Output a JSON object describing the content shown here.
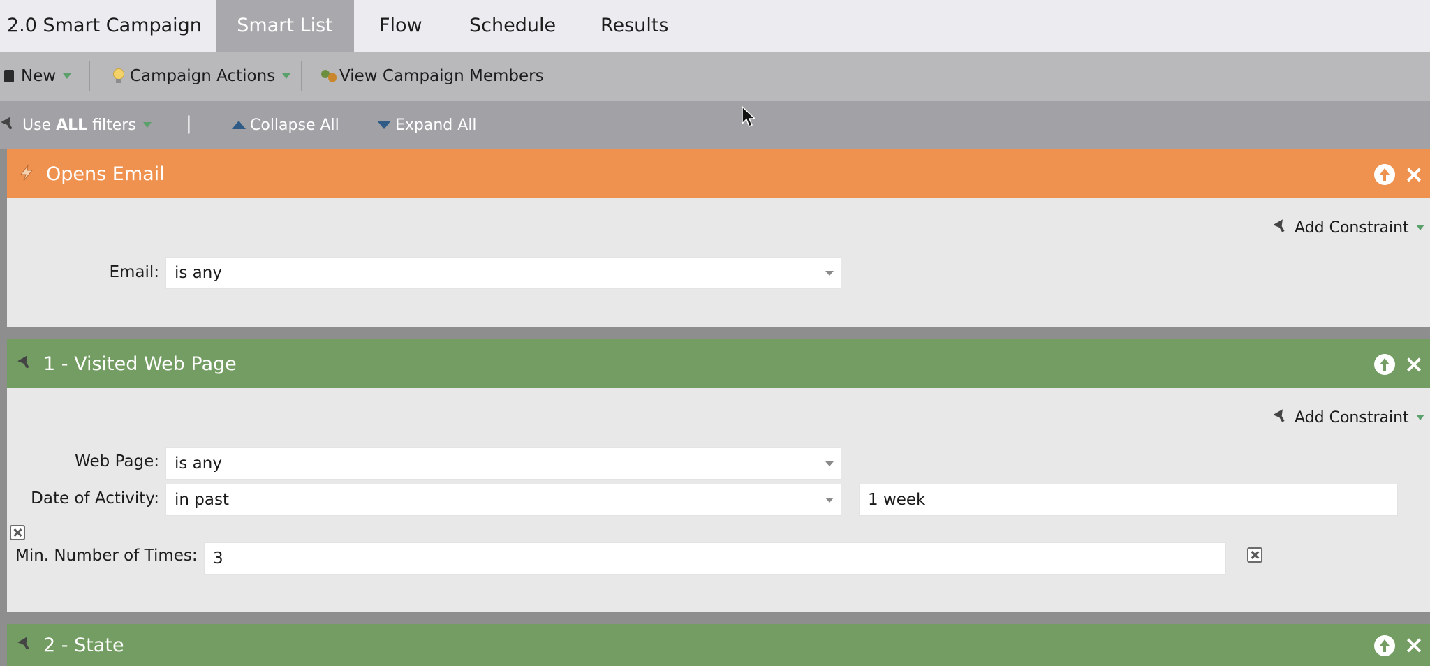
{
  "tabs": {
    "campaign_name": "2.0 Smart Campaign",
    "smart_list": "Smart List",
    "flow": "Flow",
    "schedule": "Schedule",
    "results": "Results"
  },
  "toolbar": {
    "new_label": "New",
    "campaign_actions_label": "Campaign Actions",
    "view_members_label": "View Campaign Members"
  },
  "filterbar": {
    "use_prefix": "Use ",
    "use_all": "ALL",
    "use_suffix": " filters",
    "separator": "|",
    "collapse_all": "Collapse All",
    "expand_all": "Expand All"
  },
  "filters": [
    {
      "title": "Opens Email",
      "color": "#ef9250",
      "add_constraint": "Add Constraint",
      "rows": [
        {
          "label": "Email:",
          "value": "is any"
        }
      ]
    },
    {
      "title": "1 - Visited Web Page",
      "color": "#739d62",
      "add_constraint": "Add Constraint",
      "rows": [
        {
          "label": "Web Page:",
          "value": "is any"
        },
        {
          "label": "Date of Activity:",
          "value": "in past",
          "extra": "1 week"
        },
        {
          "label": "Min. Number of Times:",
          "value": "3"
        }
      ]
    },
    {
      "title": "2 - State",
      "color": "#739d62"
    }
  ]
}
